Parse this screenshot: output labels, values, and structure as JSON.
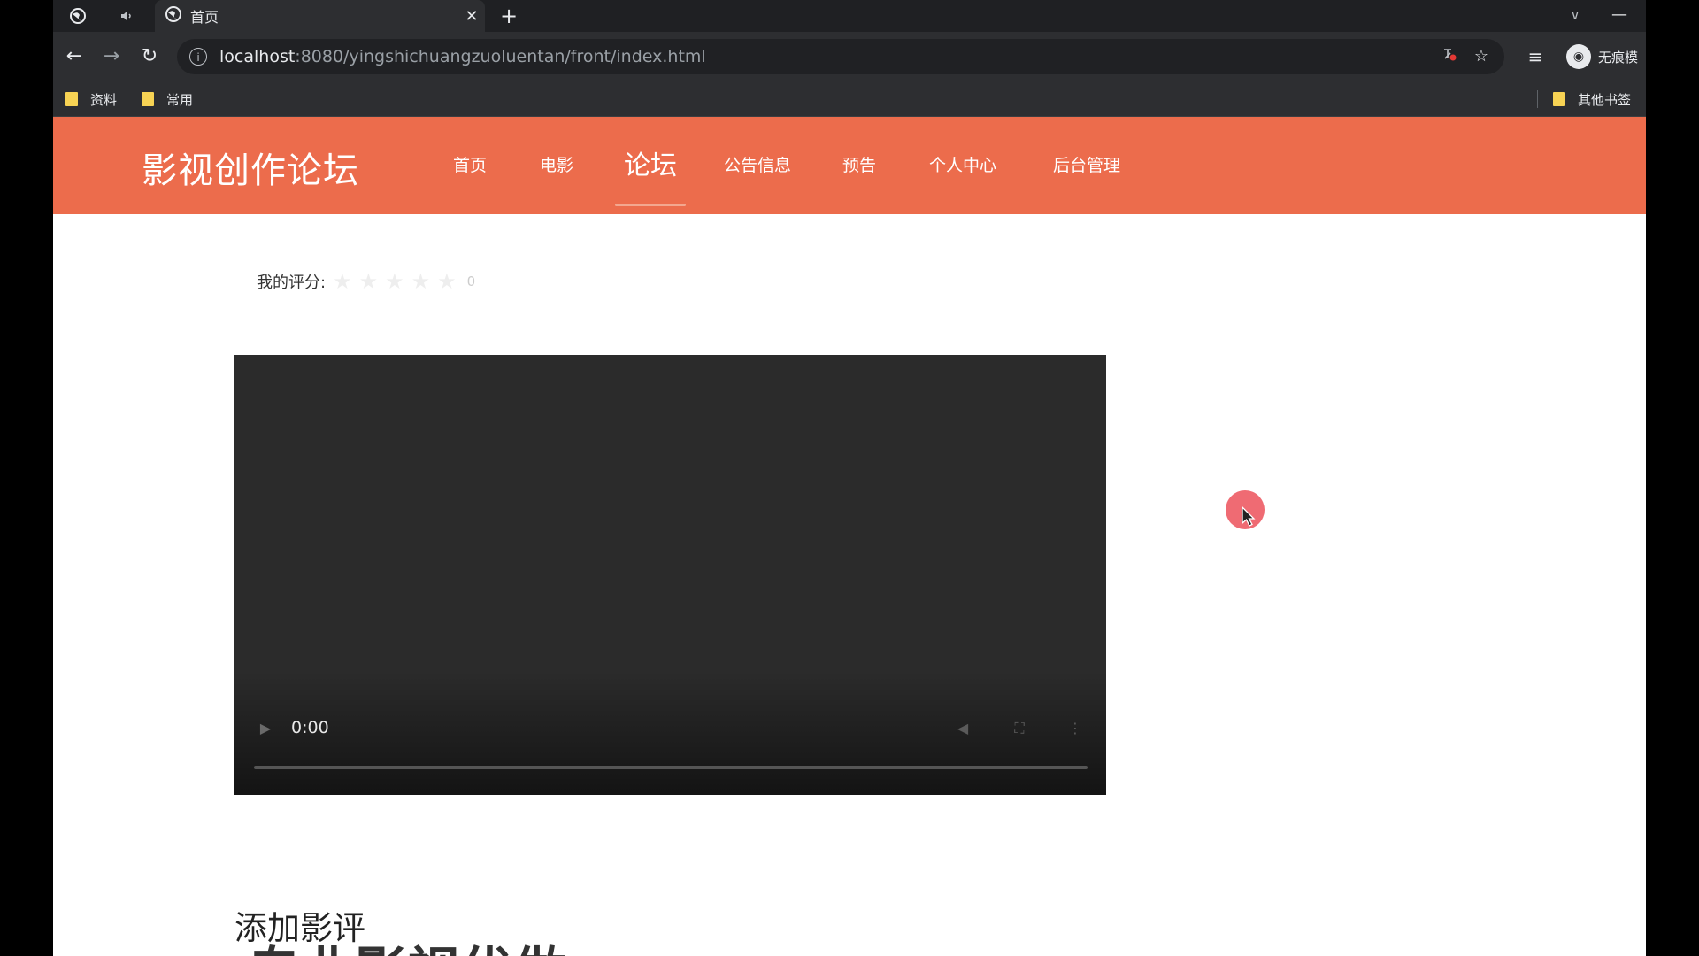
{
  "browser": {
    "active_tab_title": "首页",
    "url_host": "localhost",
    "url_path": ":8080/yingshichuangzuoluentan/front/index.html",
    "profile_name": "无痕模",
    "bookmarks": [
      "资料",
      "常用"
    ],
    "other_bookmarks": "其他书签"
  },
  "site": {
    "logo": "影视创作论坛",
    "nav": {
      "home": "首页",
      "movies": "电影",
      "forum": "论坛",
      "notices": "公告信息",
      "trailers": "预告",
      "profile": "个人中心",
      "admin": "后台管理"
    },
    "active_nav": "论坛",
    "header_color": "#ec6c4c"
  },
  "rating": {
    "label": "我的评分:",
    "stars_total": 5,
    "stars_filled": 0,
    "value": "0"
  },
  "video": {
    "time": "0:00",
    "progress": 0
  },
  "sections": {
    "add_review_title": "添加影评",
    "partial_heading": "专业影视优做"
  },
  "icons": {
    "globe": "globe-icon",
    "mute": "speaker-icon",
    "close": "close-icon",
    "plus": "plus-icon",
    "back": "arrow-left-icon",
    "forward": "arrow-right-icon",
    "reload": "reload-icon",
    "info": "info-icon",
    "star": "star-icon",
    "reading_list": "reading-list-icon",
    "play": "play-icon",
    "volume": "volume-icon",
    "fullscreen": "fullscreen-icon",
    "more": "more-vert-icon"
  }
}
